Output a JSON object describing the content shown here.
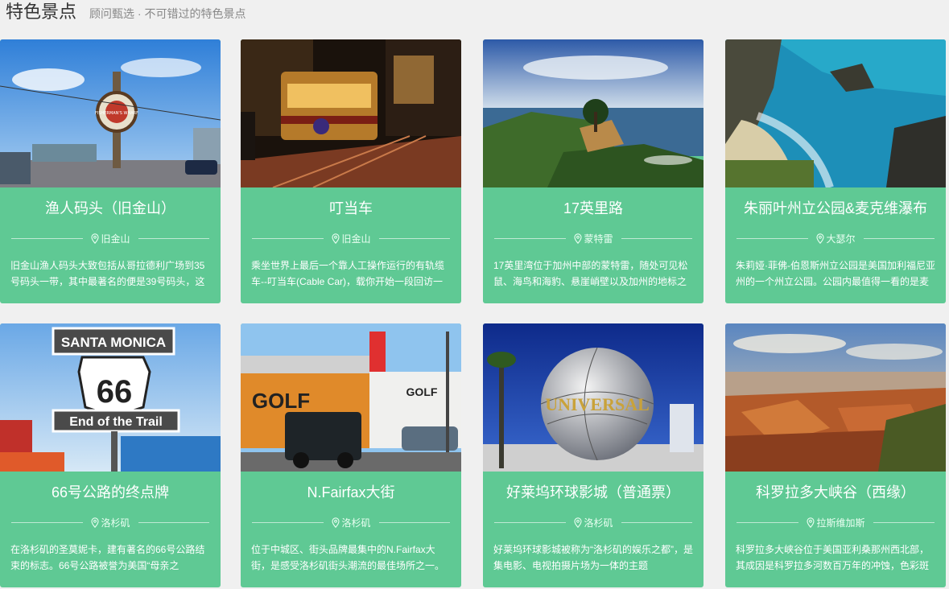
{
  "header": {
    "title": "特色景点",
    "subtitle": "顾问甄选 · 不可错过的特色景点"
  },
  "colors": {
    "card_bg": "#5fc994",
    "page_bg": "#f0f0f0"
  },
  "cards": [
    {
      "name": "渔人码头（旧金山）",
      "location": "旧金山",
      "icon": "map-pin-icon",
      "desc": "旧金山渔人码头大致包括从哥拉德利广场到35号码头一带，其中最著名的便是39号码头，这"
    },
    {
      "name": "叮当车",
      "location": "旧金山",
      "icon": "map-pin-icon",
      "desc": "乘坐世界上最后一个靠人工操作运行的有轨缆车--叮当车(Cable Car)，载你开始一段回访一"
    },
    {
      "name": "17英里路",
      "location": "蒙特雷",
      "icon": "map-pin-icon",
      "desc": "17英里湾位于加州中部的蒙特雷，随处可见松鼠、海鸟和海豹、悬崖峭壁以及加州的地标之"
    },
    {
      "name": "朱丽叶州立公园&麦克维瀑布",
      "location": "大瑟尔",
      "icon": "map-pin-icon",
      "desc": "朱莉娅·菲佛-伯恩斯州立公园是美国加利福尼亚州的一个州立公园。公园内最值得一看的是麦"
    },
    {
      "name": "66号公路的终点牌",
      "location": "洛杉矶",
      "icon": "map-pin-icon",
      "desc": "在洛杉矶的圣莫妮卡，建有著名的66号公路结束的标志。66号公路被誉为美国“母亲之"
    },
    {
      "name": "N.Fairfax大街",
      "location": "洛杉矶",
      "icon": "map-pin-icon",
      "desc": "位于中城区、街头品牌最集中的N.Fairfax大街，是感受洛杉矶街头潮流的最佳场所之一。"
    },
    {
      "name": "好莱坞环球影城（普通票）",
      "location": "洛杉矶",
      "icon": "map-pin-icon",
      "desc": "好莱坞环球影城被称为“洛杉矶的娱乐之都”，是集电影、电视拍摄片场为一体的主题"
    },
    {
      "name": "科罗拉多大峡谷（西缘）",
      "location": "拉斯维加斯",
      "icon": "map-pin-icon",
      "desc": "科罗拉多大峡谷位于美国亚利桑那州西北部，其成因是科罗拉多河数百万年的冲蚀，色彩斑"
    }
  ],
  "photos": {
    "card1": {
      "sign_text": "FISHERMAN'S WHARF"
    },
    "card2": {},
    "card3": {},
    "card4": {},
    "card5": {
      "sign_top": "SANTA MONICA",
      "sign_num": "66",
      "sign_bottom": "End of the Trail"
    },
    "card6": {
      "golf1": "GOLF",
      "golf2": "GOLF"
    },
    "card7": {
      "globe_text": "UNIVERSAL"
    },
    "card8": {}
  }
}
